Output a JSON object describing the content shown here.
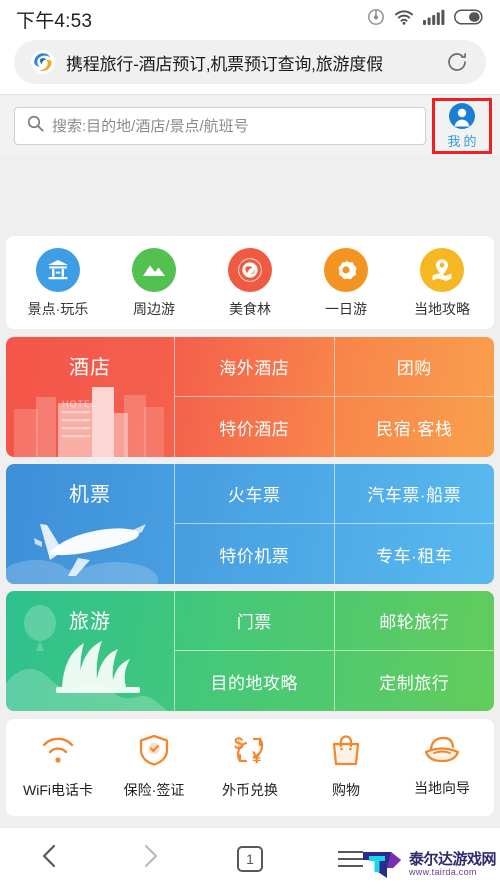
{
  "statusbar": {
    "time": "下午4:53",
    "icons": [
      "screen-cast-icon",
      "wifi-icon",
      "signal-icon",
      "battery-icon"
    ]
  },
  "browser": {
    "site_icon": "ctrip-logo-icon",
    "page_title": "携程旅行-酒店预订,机票预订查询,旅游度假",
    "reload_label": "reload-icon"
  },
  "search": {
    "icon": "search-icon",
    "placeholder": "搜索:目的地/酒店/景点/航班号",
    "value": ""
  },
  "mine": {
    "icon": "user-avatar-icon",
    "label": "我的",
    "highlight_color": "#ef2020"
  },
  "quick_icons": [
    {
      "label": "景点·玩乐",
      "icon": "pavilion-icon",
      "color": "#3e9ee5"
    },
    {
      "label": "周边游",
      "icon": "mountain-icon",
      "color": "#53c14f"
    },
    {
      "label": "美食林",
      "icon": "gourmet-seal-icon",
      "color": "#ef5b42"
    },
    {
      "label": "一日游",
      "icon": "badge-star-icon",
      "color": "#f39422"
    },
    {
      "label": "当地攻略",
      "icon": "map-pin-icon",
      "color": "#f5b722"
    }
  ],
  "blocks": [
    {
      "title": "酒店",
      "illustration": "hotel-building-icon",
      "color_start": "#f4554a",
      "color_end": "#f89a4a",
      "cells": [
        "海外酒店",
        "团购",
        "特价酒店",
        "民宿·客栈"
      ]
    },
    {
      "title": "机票",
      "illustration": "airplane-icon",
      "color_start": "#3d8fd8",
      "color_end": "#55b6ed",
      "cells": [
        "火车票",
        "汽车票·船票",
        "特价机票",
        "专车·租车"
      ]
    },
    {
      "title": "旅游",
      "illustration": "opera-house-icon",
      "color_start": "#2ec18f",
      "color_end": "#63cc5c",
      "cells": [
        "门票",
        "邮轮旅行",
        "目的地攻略",
        "定制旅行"
      ]
    }
  ],
  "services": [
    {
      "label": "WiFi电话卡",
      "icon": "wifi-signal-icon"
    },
    {
      "label": "保险·签证",
      "icon": "shield-check-icon"
    },
    {
      "label": "外币兑换",
      "icon": "currency-exchange-icon"
    },
    {
      "label": "购物",
      "icon": "shopping-bag-icon"
    },
    {
      "label": "当地向导",
      "icon": "guide-hat-icon"
    }
  ],
  "bottomnav": {
    "back": "back-chevron-icon",
    "forward": "forward-chevron-icon",
    "tab_count": "1",
    "menu": "hamburger-menu-icon"
  },
  "watermark": {
    "logo": "tairda-logo-icon",
    "name": "泰尔达游戏网",
    "url": "www.tairda.com"
  }
}
